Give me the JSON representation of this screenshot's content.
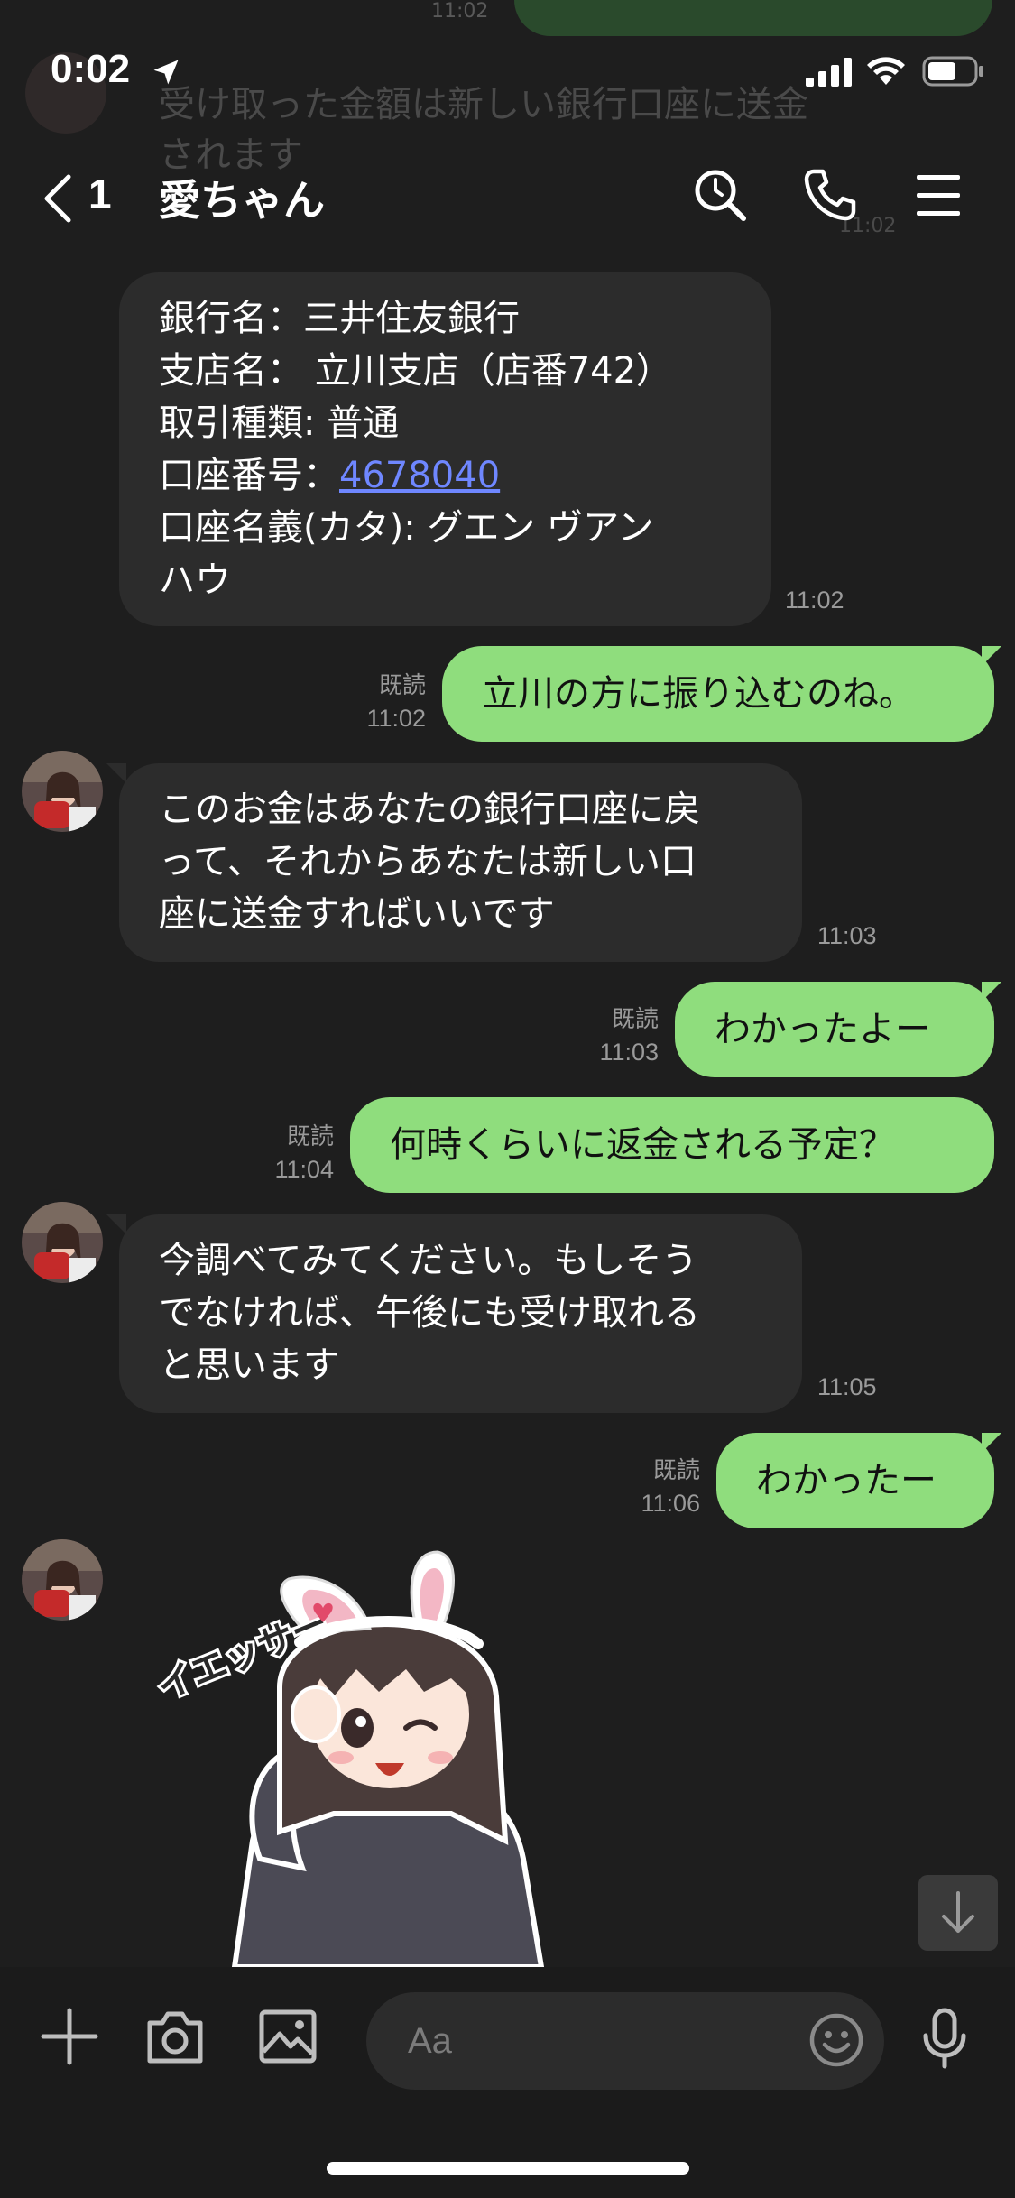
{
  "status_bar": {
    "time": "0:02"
  },
  "ghost": {
    "text": "受け取った金額は新しい銀行口座に送金されます",
    "time_top": "11:02",
    "time_mid": "11:02"
  },
  "header": {
    "back_count": "1",
    "title": "愛ちゃん"
  },
  "messages": [
    {
      "direction": "in",
      "lines": [
        "銀行名：三井住友銀行",
        "支店名：  立川支店（店番742）",
        "取引種類: 普通"
      ],
      "account_label": "口座番号：",
      "account_number": "4678040",
      "lines_after": [
        "口座名義(カタ): グエン ヴアン",
        "ハウ"
      ],
      "time": "11:02"
    },
    {
      "direction": "out",
      "read": "既読",
      "time": "11:02",
      "text": "立川の方に振り込むのね。"
    },
    {
      "direction": "in",
      "lines": [
        "このお金はあなたの銀行口座に戻",
        "って、それからあなたは新しい口",
        "座に送金すればいいです"
      ],
      "time": "11:03"
    },
    {
      "direction": "out",
      "read": "既読",
      "time": "11:03",
      "text": "わかったよー"
    },
    {
      "direction": "out",
      "read": "既読",
      "time": "11:04",
      "text": "何時くらいに返金される予定？"
    },
    {
      "direction": "in",
      "lines": [
        "今調べてみてください。もしそう",
        "でなければ、午後にも受け取れる",
        "と思います"
      ],
      "time": "11:05"
    },
    {
      "direction": "out",
      "read": "既読",
      "time": "11:06",
      "text": "わかったー"
    }
  ],
  "sticker": {
    "caption": "イエッサー"
  },
  "input": {
    "placeholder": "Aa"
  },
  "colors": {
    "background": "#1e1e1e",
    "incoming_bubble": "#2c2c2c",
    "outgoing_bubble": "#8fdd7d",
    "link": "#6f87ff"
  }
}
